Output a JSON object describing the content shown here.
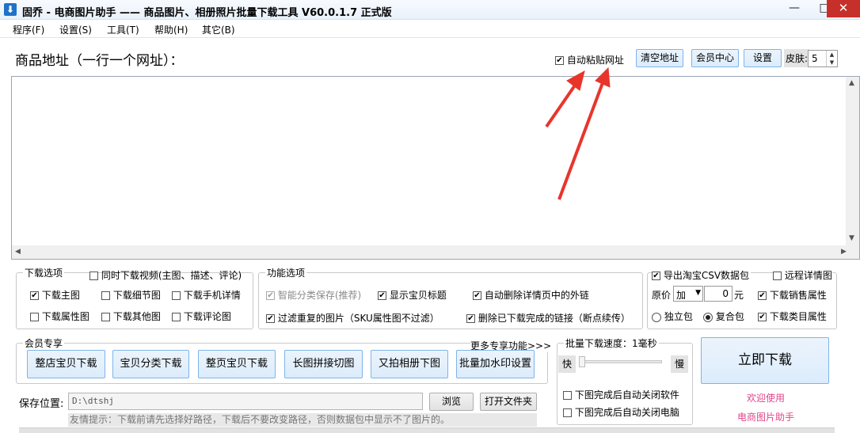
{
  "window": {
    "title": "固乔 - 电商图片助手 —— 商品图片、相册照片批量下载工具 V60.0.1.7 正式版",
    "icon": "download-app-icon",
    "minimize": "—",
    "maximize": "□",
    "close": "✕"
  },
  "menu": [
    "程序(F)",
    "设置(S)",
    "工具(T)",
    "帮助(H)",
    "其它(B)"
  ],
  "top": {
    "url_label": "商品地址（一行一个网址）：",
    "auto_paste_label": "自动粘贴网址",
    "auto_paste_checked": true,
    "clear_btn": "清空地址",
    "vip_btn": "会员中心",
    "settings_btn": "设置",
    "skin_label": "皮肤:",
    "skin_value": "5"
  },
  "url_input": {
    "value": ""
  },
  "download_options": {
    "title": "下载选项",
    "video_label": "同时下载视频(主图、描述、评论)",
    "items": [
      {
        "label": "下载主图",
        "checked": true
      },
      {
        "label": "下载细节图",
        "checked": false
      },
      {
        "label": "下载手机详情",
        "checked": false
      },
      {
        "label": "下载属性图",
        "checked": false
      },
      {
        "label": "下载其他图",
        "checked": false
      },
      {
        "label": "下载评论图",
        "checked": false
      }
    ]
  },
  "function_options": {
    "title": "功能选项",
    "items": [
      {
        "label": "智能分类保存(推荐)",
        "checked": true,
        "disabled": true
      },
      {
        "label": "显示宝贝标题",
        "checked": true
      },
      {
        "label": "自动删除详情页中的外链",
        "checked": true
      },
      {
        "label": "过滤重复的图片（SKU属性图不过滤）",
        "checked": true
      },
      {
        "label": "删除已下载完成的链接（断点续传）",
        "checked": true
      }
    ]
  },
  "csv_options": {
    "export_csv": "导出淘宝CSV数据包",
    "export_csv_checked": true,
    "remote_detail": "远程详情图",
    "price_label": "原价",
    "price_op": "加",
    "price_value": "0",
    "price_unit": "元",
    "sales_attr": "下载销售属性",
    "single_pack": "独立包",
    "combo_pack": "复合包",
    "category_attr": "下载类目属性"
  },
  "vip": {
    "title": "会员专享",
    "more": "更多专享功能>>>",
    "buttons": [
      "整店宝贝下载",
      "宝贝分类下载",
      "整页宝贝下载",
      "长图拼接切图",
      "又拍相册下图",
      "批量加水印设置"
    ]
  },
  "speed": {
    "label": "批量下载速度：1毫秒",
    "fast": "快",
    "slow": "慢",
    "level": 0,
    "close_app": "下图完成后自动关闭软件",
    "shutdown": "下图完成后自动关闭电脑"
  },
  "start_btn": "立即下载",
  "welcome": [
    "欢迎使用",
    "电商图片助手"
  ],
  "save": {
    "label": "保存位置:",
    "path": "D:\\dtshj",
    "browse": "浏览",
    "open_folder": "打开文件夹"
  },
  "hint": "友情提示：下载前请先选择好路径，下载后不要改变路径，否则数据包中显示不了图片的。",
  "colors": {
    "accent": "#1e73c8",
    "close_red": "#c7302a",
    "promo_pink": "#e0468c",
    "annotation_red": "#e8352c"
  }
}
